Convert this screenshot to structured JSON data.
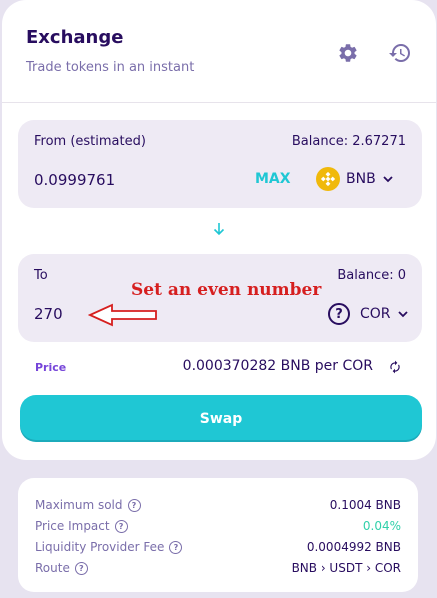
{
  "header": {
    "title": "Exchange",
    "subtitle": "Trade tokens in an instant"
  },
  "icons": {
    "settings": "gear-icon",
    "history": "history-icon",
    "switch": "arrow-down-icon",
    "refresh": "refresh-icon"
  },
  "from": {
    "label": "From (estimated)",
    "balance": "Balance: 2.67271",
    "amount": "0.0999761",
    "max_label": "MAX",
    "token": "BNB"
  },
  "to": {
    "label": "To",
    "balance": "Balance: 0",
    "amount": "270",
    "token": "COR"
  },
  "annotation": {
    "text": "Set an even number"
  },
  "price": {
    "label": "Price",
    "value": "0.000370282 BNB per COR"
  },
  "swap": {
    "label": "Swap"
  },
  "details": [
    {
      "label": "Maximum sold",
      "value": "0.1004 BNB"
    },
    {
      "label": "Price Impact",
      "value": "0.04%"
    },
    {
      "label": "Liquidity Provider Fee",
      "value": "0.0004992 BNB"
    },
    {
      "label": "Route",
      "value": "BNB › USDT › COR"
    }
  ],
  "colors": {
    "accent": "#1fc7d4",
    "text": "#280d5f",
    "secondary": "#7a6eaa",
    "success": "#31d0aa",
    "bnb": "#f0b90b",
    "annotation": "#d61f1f"
  }
}
